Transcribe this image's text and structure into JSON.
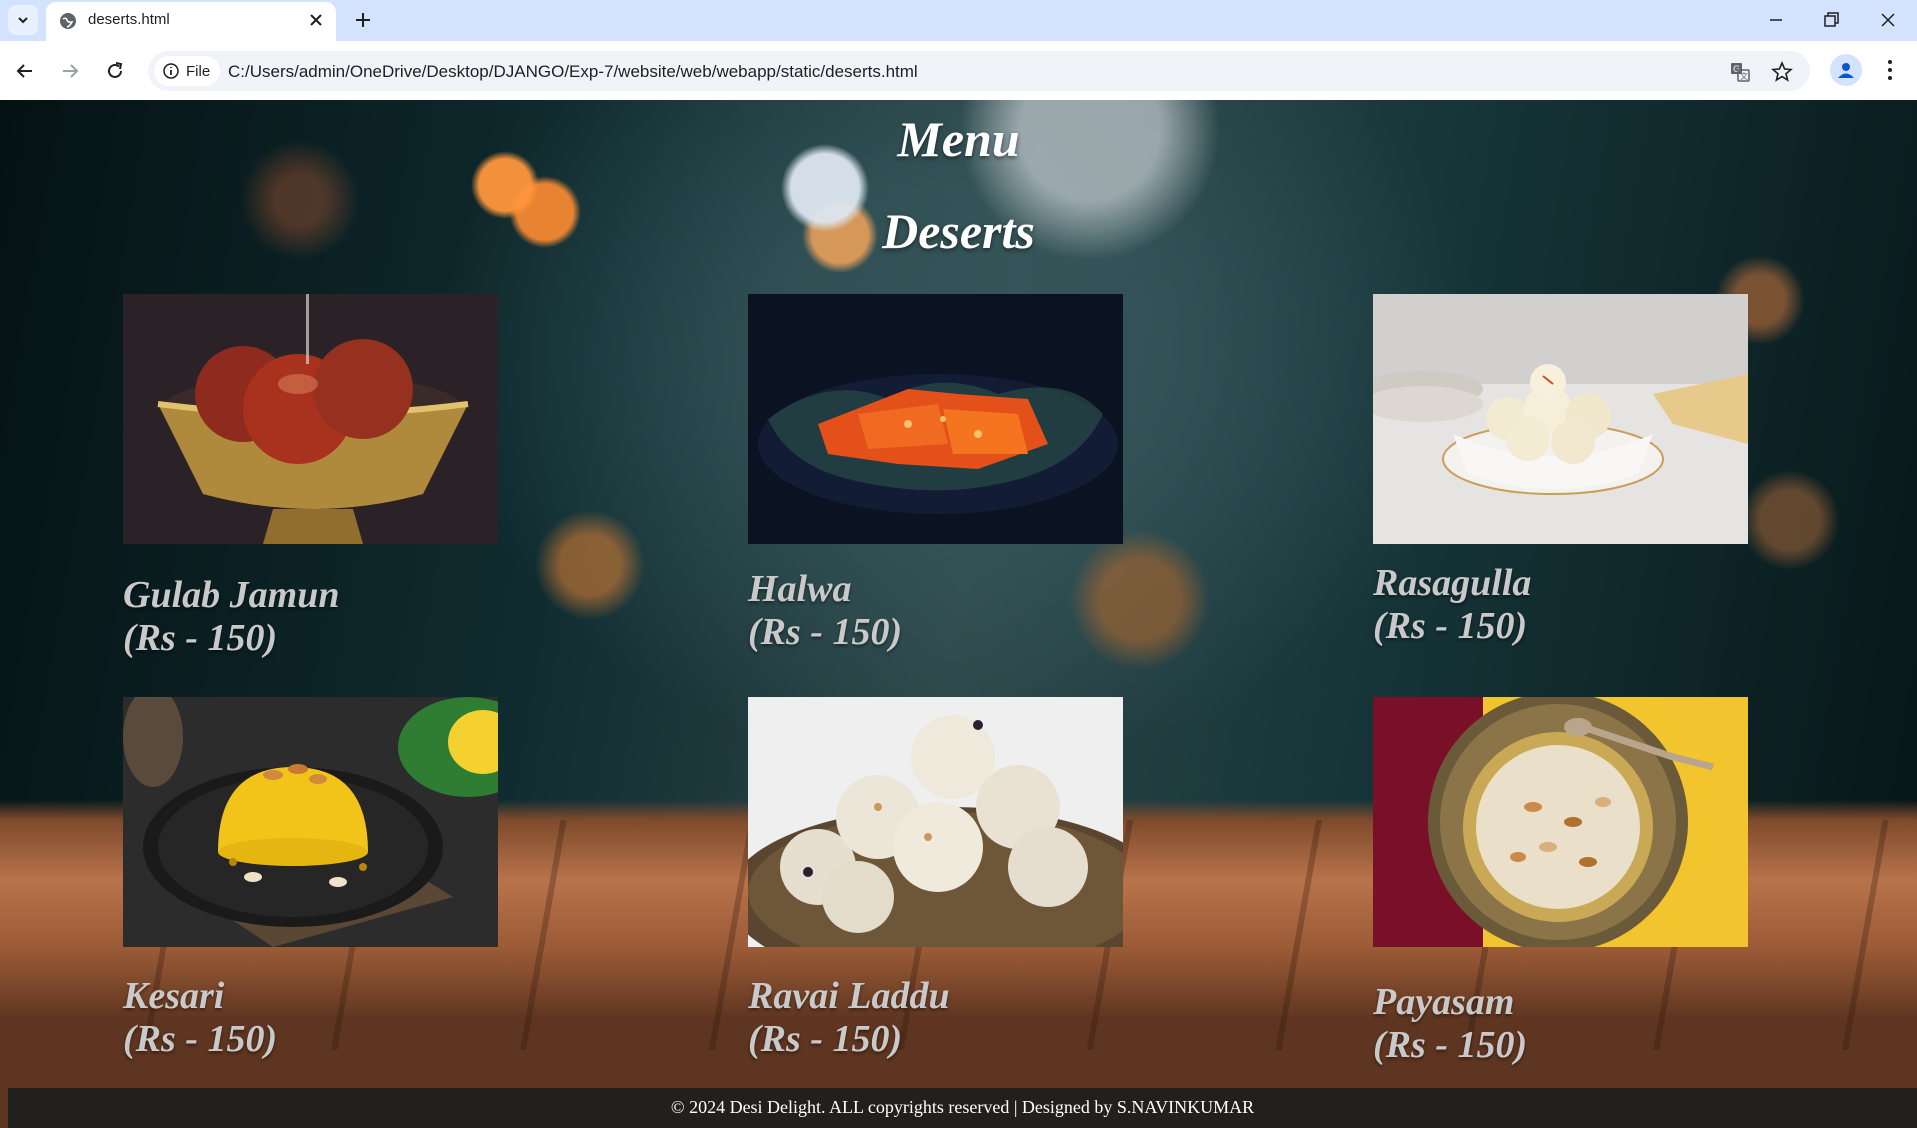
{
  "browser": {
    "tab_title": "deserts.html",
    "site_chip": "File",
    "url": "C:/Users/admin/OneDrive/Desktop/DJANGO/Exp-7/website/web/webapp/static/deserts.html"
  },
  "page": {
    "title": "Menu",
    "subtitle": "Deserts",
    "items": [
      {
        "name": "Gulab Jamun",
        "price": "(Rs - 150)"
      },
      {
        "name": "Halwa",
        "price": "(Rs - 150)"
      },
      {
        "name": "Rasagulla",
        "price": "(Rs - 150)"
      },
      {
        "name": "Kesari",
        "price": "(Rs - 150)"
      },
      {
        "name": "Ravai Laddu",
        "price": "(Rs - 150)"
      },
      {
        "name": "Payasam",
        "price": "(Rs - 150)"
      }
    ],
    "footer": "© 2024 Desi Delight. ALL copyrights reserved | Designed by S.NAVINKUMAR"
  },
  "colors": {
    "tabstrip": "#d3e3fd",
    "dish_text": "#c9c9c9",
    "footer_bg": "#22201e"
  }
}
